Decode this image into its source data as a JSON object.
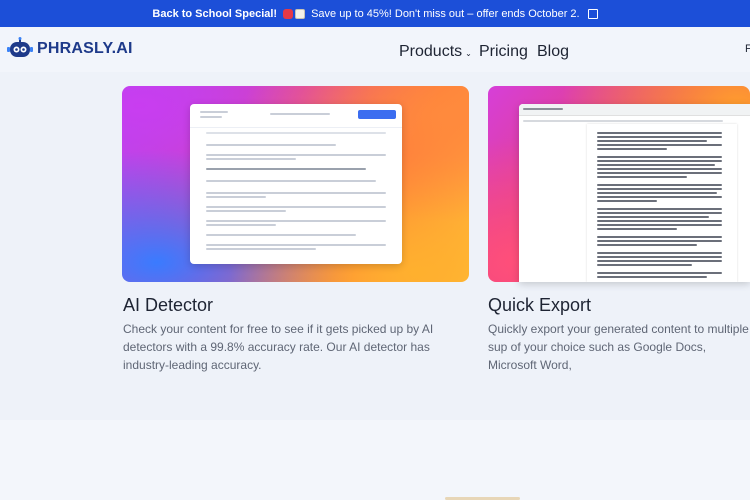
{
  "banner": {
    "title": "Back to School Special!",
    "message": "Save up to 45%! Don't miss out – offer ends October 2.",
    "emoji_icons": [
      "school-bag-icon",
      "notebook-icon"
    ],
    "link_icon": "external-link-icon"
  },
  "nav": {
    "logo_text": "PHRASLY.AI",
    "links": [
      {
        "label": "Products",
        "has_dropdown": true
      },
      {
        "label": "Pricing"
      },
      {
        "label": "Blog"
      }
    ],
    "edge_text": "F"
  },
  "features": [
    {
      "title": "AI Detector",
      "description": "Check your content for free to see if it gets picked up by AI detectors with a 99.8% accuracy rate. Our AI detector has industry-leading accuracy."
    },
    {
      "title": "Quick Export",
      "description": "Quickly export your generated content to multiple sup of your choice such as Google Docs, Microsoft Word,"
    }
  ],
  "colors": {
    "banner_bg": "#1c4fd8",
    "brand_dark": "#1e3a8a",
    "page_bg": "#eef2f9"
  }
}
